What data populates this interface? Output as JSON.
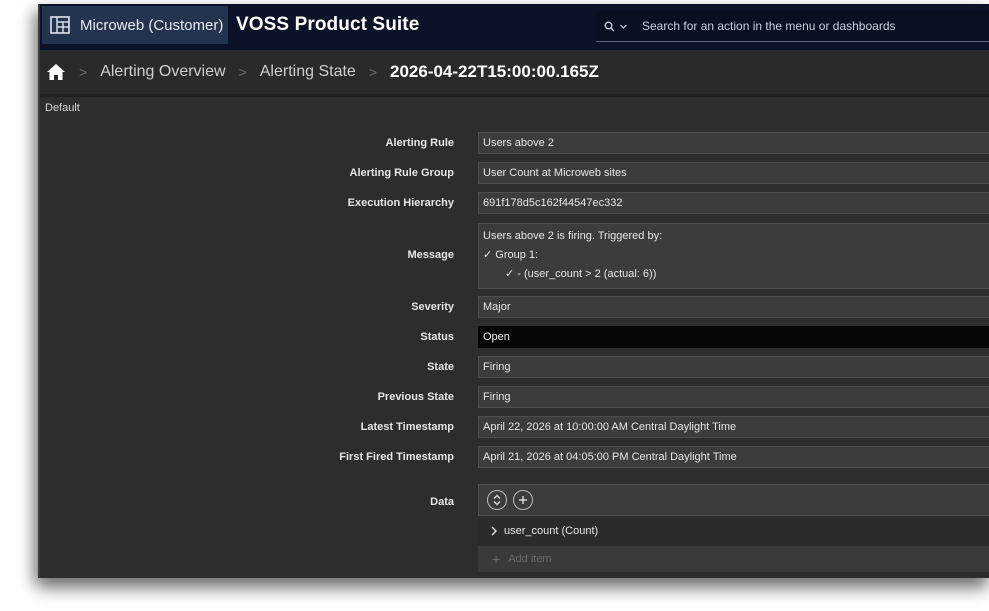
{
  "header": {
    "tenant": "Microweb (Customer)",
    "app_title": "VOSS Product Suite",
    "search_placeholder": "Search for an action in the menu or dashboards"
  },
  "breadcrumb": {
    "items": [
      "Alerting Overview",
      "Alerting State"
    ],
    "current": "2026-04-22T15:00:00.165Z"
  },
  "section_label": "Default",
  "form": {
    "alerting_rule": {
      "label": "Alerting Rule",
      "value": "Users above 2"
    },
    "alerting_rule_group": {
      "label": "Alerting Rule Group",
      "value": "User Count at Microweb sites"
    },
    "execution_hierarchy": {
      "label": "Execution Hierarchy",
      "value": "691f178d5c162f44547ec332"
    },
    "message": {
      "label": "Message",
      "line1": "Users above 2 is firing. Triggered by:",
      "line2": "✓ Group 1:",
      "line3": "✓ - (user_count > 2 (actual: 6))"
    },
    "severity": {
      "label": "Severity",
      "value": "Major"
    },
    "status": {
      "label": "Status",
      "value": "Open"
    },
    "state": {
      "label": "State",
      "value": "Firing"
    },
    "previous_state": {
      "label": "Previous State",
      "value": "Firing"
    },
    "latest_timestamp": {
      "label": "Latest Timestamp",
      "value": "April 22, 2026 at 10:00:00 AM Central Daylight Time"
    },
    "first_fired_timestamp": {
      "label": "First Fired Timestamp",
      "value": "April 21, 2026 at 04:05:00 PM Central Daylight Time"
    },
    "data": {
      "label": "Data",
      "item": "user_count (Count)",
      "add_item": "Add item"
    }
  }
}
